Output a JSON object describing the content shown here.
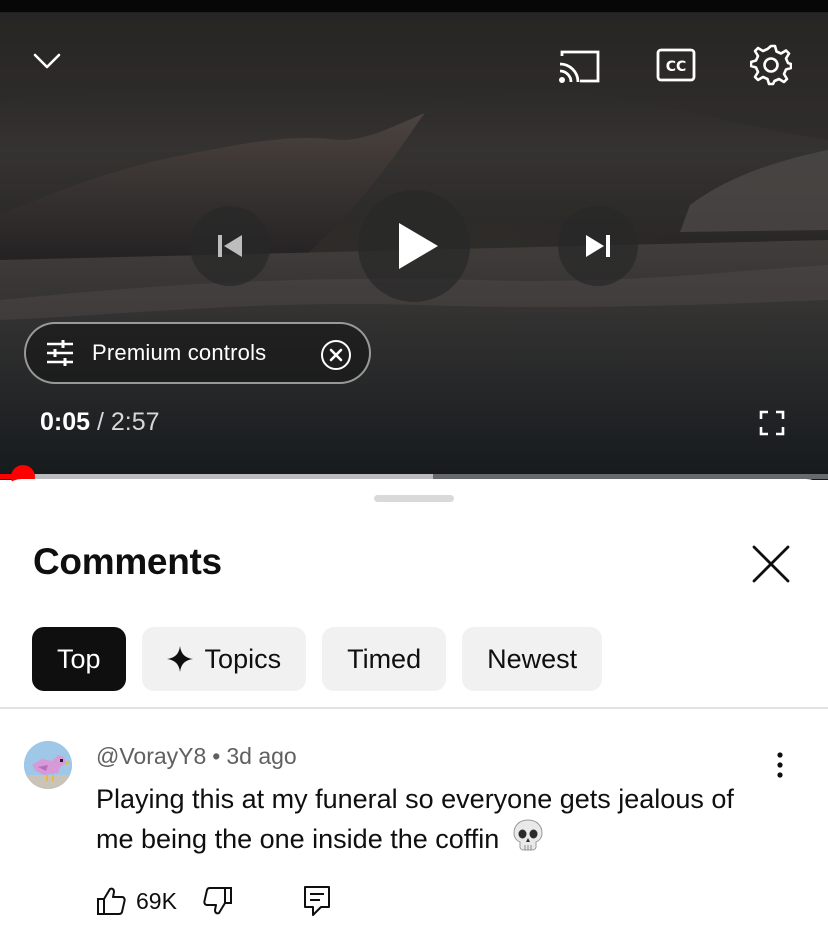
{
  "player": {
    "current_time": "0:05",
    "separator": "/",
    "duration": "2:57",
    "progress_fraction": 0.028,
    "buffered_fraction": 0.523,
    "premium_controls_label": "Premium controls",
    "icons": {
      "collapse": "chevron-down-icon",
      "cast": "cast-icon",
      "captions": "cc-icon",
      "settings": "gear-icon",
      "previous": "skip-previous-icon",
      "play": "play-icon",
      "next": "skip-next-icon",
      "premium": "sliders-icon",
      "premium_close": "close-circle-icon",
      "fullscreen": "fullscreen-icon"
    },
    "accent_color": "#ff0000"
  },
  "comments_sheet": {
    "title": "Comments",
    "close_icon": "close-icon",
    "chips": [
      {
        "label": "Top",
        "active": true
      },
      {
        "label": "Topics",
        "active": false,
        "icon": "sparkle-icon"
      },
      {
        "label": "Timed",
        "active": false
      },
      {
        "label": "Newest",
        "active": false
      }
    ],
    "comments": [
      {
        "author": "@VorayY8",
        "meta_dot": "•",
        "time": "3d ago",
        "text": "Playing this at my funeral so everyone gets jealous of me being the one inside the coffin",
        "emoji": "skull-emoji",
        "like_count": "69K",
        "icons": {
          "like": "thumbs-up-icon",
          "dislike": "thumbs-down-icon",
          "reply": "reply-icon",
          "menu": "more-vertical-icon"
        }
      }
    ]
  }
}
